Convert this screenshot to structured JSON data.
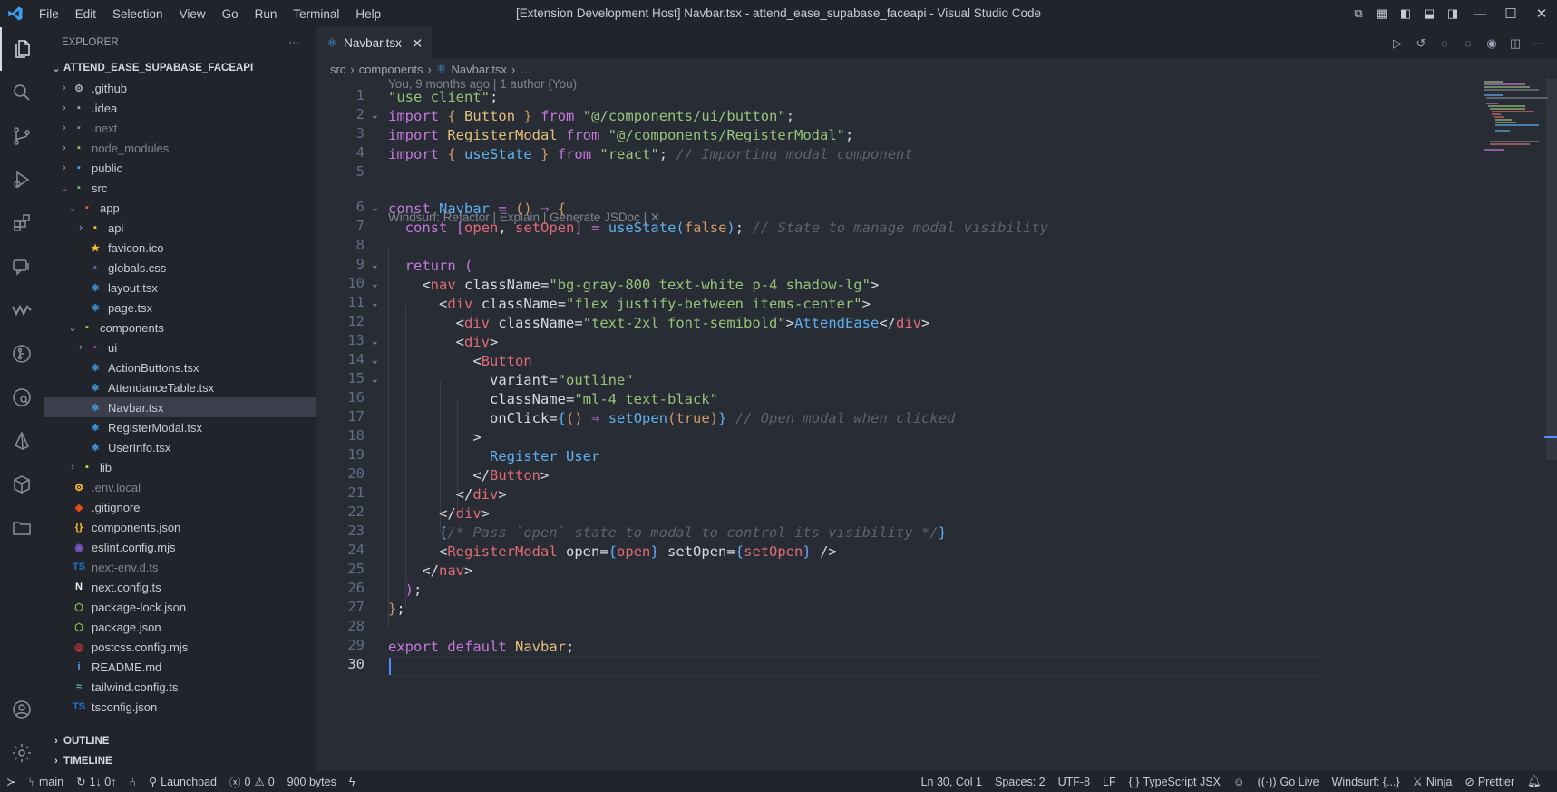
{
  "titlebar": {
    "menu": [
      "File",
      "Edit",
      "Selection",
      "View",
      "Go",
      "Run",
      "Terminal",
      "Help"
    ],
    "title": "[Extension Development Host] Navbar.tsx - attend_ease_supabase_faceapi - Visual Studio Code"
  },
  "sidebar": {
    "header": "EXPLORER",
    "more": "···",
    "root": "ATTEND_EASE_SUPABASE_FACEAPI",
    "items": [
      {
        "label": ".github",
        "depth": 1,
        "chev": "›",
        "icon": "⚙",
        "color": "#9da5b4",
        "muted": false
      },
      {
        "label": ".idea",
        "depth": 1,
        "chev": "›",
        "icon": "▪",
        "color": "#9da5b4",
        "muted": false
      },
      {
        "label": ".next",
        "depth": 1,
        "chev": "›",
        "icon": "▪",
        "color": "#7f848e",
        "muted": true
      },
      {
        "label": "node_modules",
        "depth": 1,
        "chev": "›",
        "icon": "▪",
        "color": "#8bc34a",
        "muted": true
      },
      {
        "label": "public",
        "depth": 1,
        "chev": "›",
        "icon": "▪",
        "color": "#42a5f5",
        "muted": false
      },
      {
        "label": "src",
        "depth": 1,
        "chev": "⌄",
        "icon": "▪",
        "color": "#66bb6a",
        "muted": false
      },
      {
        "label": "app",
        "depth": 2,
        "chev": "⌄",
        "icon": "▪",
        "color": "#ef5350",
        "muted": false
      },
      {
        "label": "api",
        "depth": 3,
        "chev": "›",
        "icon": "▪",
        "color": "#fbc02d",
        "muted": false
      },
      {
        "label": "favicon.ico",
        "depth": 3,
        "chev": "",
        "icon": "★",
        "color": "#fbc02d",
        "muted": false
      },
      {
        "label": "globals.css",
        "depth": 3,
        "chev": "",
        "icon": "▪",
        "color": "#7e57c2",
        "muted": false
      },
      {
        "label": "layout.tsx",
        "depth": 3,
        "chev": "",
        "icon": "⚛",
        "color": "#42a5f5",
        "muted": false
      },
      {
        "label": "page.tsx",
        "depth": 3,
        "chev": "",
        "icon": "⚛",
        "color": "#42a5f5",
        "muted": false
      },
      {
        "label": "components",
        "depth": 2,
        "chev": "⌄",
        "icon": "▪",
        "color": "#c0ca33",
        "muted": false
      },
      {
        "label": "ui",
        "depth": 3,
        "chev": "›",
        "icon": "▪",
        "color": "#ab47bc",
        "muted": false
      },
      {
        "label": "ActionButtons.tsx",
        "depth": 3,
        "chev": "",
        "icon": "⚛",
        "color": "#42a5f5",
        "muted": false
      },
      {
        "label": "AttendanceTable.tsx",
        "depth": 3,
        "chev": "",
        "icon": "⚛",
        "color": "#42a5f5",
        "muted": false
      },
      {
        "label": "Navbar.tsx",
        "depth": 3,
        "chev": "",
        "icon": "⚛",
        "color": "#42a5f5",
        "muted": false,
        "selected": true
      },
      {
        "label": "RegisterModal.tsx",
        "depth": 3,
        "chev": "",
        "icon": "⚛",
        "color": "#42a5f5",
        "muted": false
      },
      {
        "label": "UserInfo.tsx",
        "depth": 3,
        "chev": "",
        "icon": "⚛",
        "color": "#42a5f5",
        "muted": false
      },
      {
        "label": "lib",
        "depth": 2,
        "chev": "›",
        "icon": "▪",
        "color": "#cddc39",
        "muted": false
      },
      {
        "label": ".env.local",
        "depth": 1,
        "chev": "",
        "icon": "⚙",
        "color": "#fbc02d",
        "muted": true
      },
      {
        "label": ".gitignore",
        "depth": 1,
        "chev": "",
        "icon": "◆",
        "color": "#e64a19",
        "muted": false
      },
      {
        "label": "components.json",
        "depth": 1,
        "chev": "",
        "icon": "{}",
        "color": "#fbc02d",
        "muted": false
      },
      {
        "label": "eslint.config.mjs",
        "depth": 1,
        "chev": "",
        "icon": "◉",
        "color": "#7e57c2",
        "muted": false
      },
      {
        "label": "next-env.d.ts",
        "depth": 1,
        "chev": "",
        "icon": "TS",
        "color": "#1976d2",
        "muted": true
      },
      {
        "label": "next.config.ts",
        "depth": 1,
        "chev": "",
        "icon": "N",
        "color": "#eeeeee",
        "muted": false
      },
      {
        "label": "package-lock.json",
        "depth": 1,
        "chev": "",
        "icon": "⬡",
        "color": "#8bc34a",
        "muted": false
      },
      {
        "label": "package.json",
        "depth": 1,
        "chev": "",
        "icon": "⬡",
        "color": "#8bc34a",
        "muted": false
      },
      {
        "label": "postcss.config.mjs",
        "depth": 1,
        "chev": "",
        "icon": "◎",
        "color": "#e53935",
        "muted": false
      },
      {
        "label": "README.md",
        "depth": 1,
        "chev": "",
        "icon": "i",
        "color": "#42a5f5",
        "muted": false
      },
      {
        "label": "tailwind.config.ts",
        "depth": 1,
        "chev": "",
        "icon": "≈",
        "color": "#4db6ac",
        "muted": false
      },
      {
        "label": "tsconfig.json",
        "depth": 1,
        "chev": "",
        "icon": "TS",
        "color": "#1976d2",
        "muted": false
      }
    ],
    "outline": "OUTLINE",
    "timeline": "TIMELINE"
  },
  "editor": {
    "tab": "Navbar.tsx",
    "breadcrumb": [
      "src",
      "components",
      "Navbar.tsx",
      "…"
    ],
    "blame": "You, 9 months ago | 1 author (You)",
    "codelens": "Windsurf: Refactor | Explain | Generate JSDoc | ✕",
    "lines": [
      "1",
      "2",
      "3",
      "4",
      "5",
      "6",
      "7",
      "8",
      "9",
      "10",
      "11",
      "12",
      "13",
      "14",
      "15",
      "16",
      "17",
      "18",
      "19",
      "20",
      "21",
      "22",
      "23",
      "24",
      "25",
      "26",
      "27",
      "28",
      "29",
      "30"
    ]
  },
  "statusbar": {
    "branch": "main",
    "sync": "1↓ 0↑",
    "launchpad": "Launchpad",
    "problems": "0",
    "warnings": "0",
    "size": "900 bytes",
    "position": "Ln 30, Col 1",
    "spaces": "Spaces: 2",
    "encoding": "UTF-8",
    "eol": "LF",
    "language": "TypeScript JSX",
    "golive": "Go Live",
    "windsurf": "Windsurf: {...}",
    "ninja": "Ninja",
    "prettier": "Prettier"
  }
}
